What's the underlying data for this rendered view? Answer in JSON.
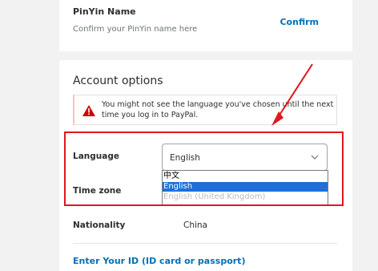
{
  "pinyin": {
    "title": "PinYin Name",
    "hint": "Confirm your PinYin name here",
    "confirm_label": "Confirm"
  },
  "account": {
    "section_title": "Account options",
    "warning": {
      "icon": "warning-icon",
      "text": "You might not see the language you've chosen until the next time you log in to PayPal."
    },
    "language": {
      "label": "Language",
      "selected": "English",
      "options": [
        "中文",
        "English",
        "English (United Kingdom)"
      ]
    },
    "timezone": {
      "label": "Time zone"
    },
    "nationality": {
      "label": "Nationality",
      "value": "China"
    },
    "id_link": "Enter Your ID (ID card or passport)"
  },
  "colors": {
    "link": "#0070ba",
    "highlight": "#e0171b",
    "selected_option": "#1e6fd9",
    "warning_icon": "#d20000"
  }
}
